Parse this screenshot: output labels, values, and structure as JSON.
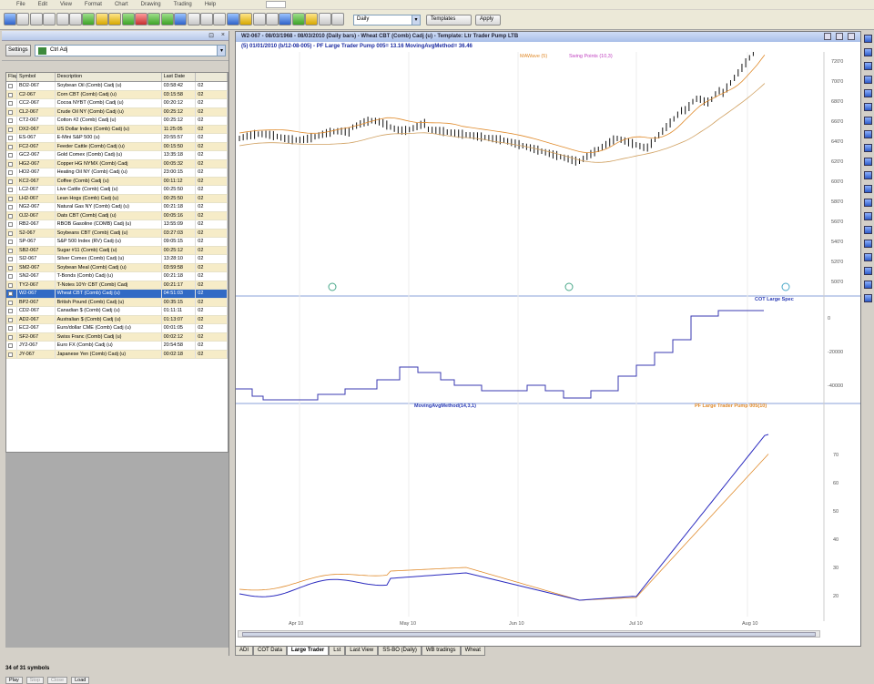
{
  "menu": [
    "File",
    "Edit",
    "View",
    "Format",
    "Chart",
    "Drawing",
    "Trading",
    "Help"
  ],
  "toolbar": {
    "interval": "Daily",
    "btn_template": "Templates",
    "btn_apply": "Apply"
  },
  "left_panel": {
    "settings_label": "Settings",
    "list_name": "Ctrl Adj",
    "columns": [
      "Flag",
      "Symbol",
      "Description",
      "Last Date",
      ""
    ],
    "rows": [
      {
        "sym": "BO2-067",
        "desc": "Soybean Oil (Comb) Cadj (u)",
        "date": "03:58:42",
        "x": "02"
      },
      {
        "sym": "C2-067",
        "desc": "Corn CBT (Comb) Cadj (u)",
        "date": "03:15:58",
        "x": "02"
      },
      {
        "sym": "CC2-067",
        "desc": "Cocoa NYBT (Comb) Cadj (u)",
        "date": "00:20:12",
        "x": "02"
      },
      {
        "sym": "CL2-067",
        "desc": "Crude Oil NY (Comb) Cadj (u)",
        "date": "00:25:12",
        "x": "02"
      },
      {
        "sym": "CT2-067",
        "desc": "Cotton #2 (Comb) Cadj (u)",
        "date": "00:25:12",
        "x": "02"
      },
      {
        "sym": "DX2-067",
        "desc": "US Dollar Index (Comb) Cadj (u)",
        "date": "11:25:05",
        "x": "02"
      },
      {
        "sym": "ES-067",
        "desc": "E-Mini S&P 500 (u)",
        "date": "20:55:57",
        "x": "02"
      },
      {
        "sym": "FC2-067",
        "desc": "Feeder Cattle (Comb) Cadj (u)",
        "date": "00:15:50",
        "x": "02"
      },
      {
        "sym": "GC2-067",
        "desc": "Gold Comex (Comb) Cadj (u)",
        "date": "13:35:18",
        "x": "02"
      },
      {
        "sym": "HG2-067",
        "desc": "Copper HG NYMX (Comb) Cadj",
        "date": "00:05:32",
        "x": "02"
      },
      {
        "sym": "HO2-067",
        "desc": "Heating Oil NY (Comb) Cadj (u)",
        "date": "23:00:15",
        "x": "02"
      },
      {
        "sym": "KC2-067",
        "desc": "Coffee (Comb) Cadj (u)",
        "date": "00:11:12",
        "x": "02"
      },
      {
        "sym": "LC2-067",
        "desc": "Live Cattle (Comb) Cadj (u)",
        "date": "00:25:50",
        "x": "02"
      },
      {
        "sym": "LH2-067",
        "desc": "Lean Hogs (Comb) Cadj (u)",
        "date": "00:25:50",
        "x": "02"
      },
      {
        "sym": "NG2-067",
        "desc": "Natural Gas NY (Comb) Cadj (u)",
        "date": "00:21:18",
        "x": "02"
      },
      {
        "sym": "OJ2-067",
        "desc": "Oats CBT (Comb) Cadj (u)",
        "date": "00:05:16",
        "x": "02"
      },
      {
        "sym": "RB2-067",
        "desc": "RBOB Gasoline (COMB) Cadj (u)",
        "date": "13:55:09",
        "x": "02"
      },
      {
        "sym": "S2-067",
        "desc": "Soybeans CBT (Comb) Cadj (u)",
        "date": "03:27:03",
        "x": "02"
      },
      {
        "sym": "SP-067",
        "desc": "S&P 500 Index (RV) Cadj (u)",
        "date": "09:05:15",
        "x": "02"
      },
      {
        "sym": "SB2-067",
        "desc": "Sugar #11 (Comb) Cadj (u)",
        "date": "00:25:12",
        "x": "02"
      },
      {
        "sym": "SI2-067",
        "desc": "Silver Comex (Comb) Cadj (u)",
        "date": "13:28:10",
        "x": "02"
      },
      {
        "sym": "SM2-067",
        "desc": "Soybean Meal (Comb) Cadj (u)",
        "date": "03:59:58",
        "x": "02"
      },
      {
        "sym": "SN2-067",
        "desc": "T-Bonds (Comb) Cadj (u)",
        "date": "00:21:18",
        "x": "02"
      },
      {
        "sym": "TY2-067",
        "desc": "T-Notes 10Yr CBT (Comb) Cadj",
        "date": "00:21:17",
        "x": "02"
      },
      {
        "sym": "W2-067",
        "desc": "Wheat CBT (Comb) Cadj (u)",
        "date": "04:51:03",
        "x": "02"
      },
      {
        "sym": "BP2-067",
        "desc": "British Pound (Comb) Cadj (u)",
        "date": "00:35:15",
        "x": "02"
      },
      {
        "sym": "CD2-067",
        "desc": "Canadian $ (Comb) Cadj (u)",
        "date": "01:11:11",
        "x": "02"
      },
      {
        "sym": "AD2-067",
        "desc": "Australian $ (Comb) Cadj (u)",
        "date": "01:13:07",
        "x": "02"
      },
      {
        "sym": "EC2-067",
        "desc": "Euro/dollar CME (Comb) Cadj (u)",
        "date": "00:01:05",
        "x": "02"
      },
      {
        "sym": "SF2-067",
        "desc": "Swiss Franc (Comb) Cadj (u)",
        "date": "00:02:12",
        "x": "02"
      },
      {
        "sym": "JY2-067",
        "desc": "Euro FX (Comb) Cadj (u)",
        "date": "20:54:58",
        "x": "02"
      },
      {
        "sym": "JY-067",
        "desc": "Japanese Yen (Comb) Cadj (u)",
        "date": "00:02:18",
        "x": "02"
      }
    ],
    "selected_index": 24,
    "count_text": "34 of 31 symbols",
    "bottom_buttons": [
      "Play",
      "Stop",
      "Close",
      "Load"
    ]
  },
  "chart": {
    "title": "W2-067 - 08/03/1968 - 08/03/2010 (Daily bars) - Wheat CBT (Comb) Cadj (u) - Template: Ltr Trader Pump LTB",
    "subtitle": "(5)  01/01/2010 (b/12-08-005) - PF Large Trader Pump 005= 13.16  MovingAvgMethod= 36.46",
    "indicator_legend_1": "MAWave (5)",
    "indicator_legend_2": "Swing Points (10,3)",
    "pane2_label": "COT Large Spec",
    "pane3_label_a": "MovingAvgMethod(14,3,1)",
    "pane3_label_b": "PF Large Trader Pump 005(10)",
    "x_labels": [
      "Apr 10",
      "May 10",
      "Jun 10",
      "Jul 10",
      "Aug 10"
    ],
    "price_ticks": [
      "720'0",
      "700'0",
      "680'0",
      "660'0",
      "640'0",
      "620'0",
      "600'0",
      "580'0",
      "560'0",
      "540'0",
      "520'0",
      "500'0"
    ],
    "pane2_ticks": [
      "0",
      "-20000",
      "-40000"
    ],
    "pane3_ticks": [
      "70",
      "60",
      "50",
      "40",
      "30",
      "20"
    ]
  },
  "bottom_tabs": [
    "ADI",
    "COT Data",
    "Large Trader",
    "Lst",
    "Last View",
    "SS-BO (Daily)",
    "WB tradings",
    "Wheat"
  ],
  "active_tab_index": 2,
  "colors": {
    "price_line": "#2b2bdc",
    "bars": "#000000",
    "mawave": "#e08a2a",
    "ma2": "#d0a060",
    "cot": "#3a3ab0",
    "osc_a": "#2b2bbf",
    "osc_b": "#e08a2a",
    "selection": "#316ac5"
  }
}
